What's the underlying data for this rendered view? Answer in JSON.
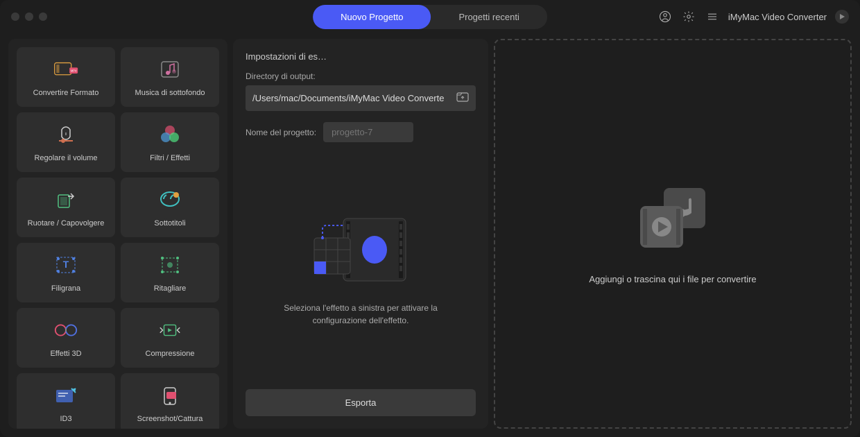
{
  "header": {
    "tabs": {
      "new": "Nuovo Progetto",
      "recent": "Progetti recenti"
    },
    "app_title": "iMyMac Video Converter"
  },
  "sidebar": {
    "tools": [
      {
        "label": "Convertire Formato",
        "icon": "convert"
      },
      {
        "label": "Musica di sottofondo",
        "icon": "music-bg"
      },
      {
        "label": "Regolare il volume",
        "icon": "volume"
      },
      {
        "label": "Filtri / Effetti",
        "icon": "filters"
      },
      {
        "label": "Ruotare / Capovolgere",
        "icon": "rotate"
      },
      {
        "label": "Sottotitoli",
        "icon": "subtitles"
      },
      {
        "label": "Filigrana",
        "icon": "watermark"
      },
      {
        "label": "Ritagliare",
        "icon": "crop"
      },
      {
        "label": "Effetti 3D",
        "icon": "effects-3d"
      },
      {
        "label": "Compressione",
        "icon": "compress"
      },
      {
        "label": "ID3",
        "icon": "id3"
      },
      {
        "label": "Screenshot/Cattura",
        "icon": "screenshot"
      }
    ]
  },
  "center": {
    "title": "Impostazioni di es…",
    "dir_label": "Directory di output:",
    "dir_value": "/Users/mac/Documents/iMyMac Video Converte",
    "name_label": "Nome del progetto:",
    "name_placeholder": "progetto-7",
    "preview_text": "Seleziona l'effetto a sinistra per attivare la configurazione dell'effetto.",
    "export_label": "Esporta"
  },
  "drop": {
    "text": "Aggiungi o trascina qui i file per convertire"
  }
}
